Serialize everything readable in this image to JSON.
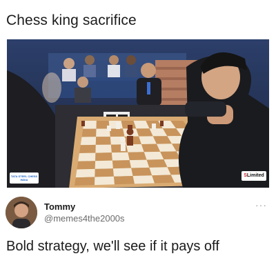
{
  "meme": {
    "caption": "Chess king sacrifice"
  },
  "photo": {
    "left_logo_text": "TATA STEEL CHESS INDIA",
    "right_logo_prefix": "S",
    "right_logo_text": "Limited",
    "board_colors": {
      "light_square": "#f3e9d6",
      "dark_square": "#c8945c",
      "board_frame": "#d9ab73"
    }
  },
  "post": {
    "username": "Tommy",
    "handle": "@memes4the2000s",
    "more_icon": "more-options-icon",
    "more_glyph": "···",
    "text": "Bold strategy, we'll see if it pays off"
  }
}
